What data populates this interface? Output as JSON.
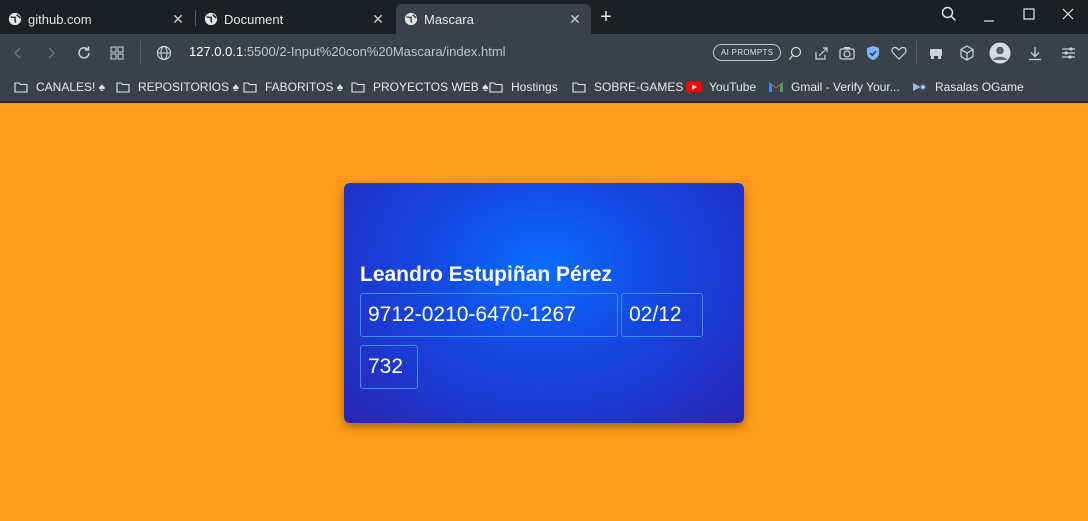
{
  "browser": {
    "tabs": [
      {
        "title": "github.com",
        "icon": "globe-icon"
      },
      {
        "title": "Document",
        "icon": "globe-icon"
      },
      {
        "title": "Mascara",
        "icon": "globe-icon"
      }
    ],
    "active_tab": 2,
    "url": {
      "host": "127.0.0.1",
      "path": ":5500/2-Input%20con%20Mascara/index.html"
    },
    "ai_prompts_label": "AI PROMPTS"
  },
  "bookmarks": [
    {
      "label": "CANALES! ♠",
      "icon": "folder-icon"
    },
    {
      "label": "REPOSITORIOS ♠",
      "icon": "folder-icon"
    },
    {
      "label": "FABORITOS ♠",
      "icon": "folder-icon"
    },
    {
      "label": "PROYECTOS WEB ♠",
      "icon": "folder-icon"
    },
    {
      "label": "Hostings",
      "icon": "folder-icon"
    },
    {
      "label": "SOBRE-GAMES",
      "icon": "folder-icon"
    },
    {
      "label": "YouTube",
      "icon": "youtube-icon"
    },
    {
      "label": "Gmail - Verify Your...",
      "icon": "gmail-icon"
    },
    {
      "label": "Rasalas OGame",
      "icon": "ogame-icon"
    }
  ],
  "card": {
    "holder_name": "Leandro Estupiñan Pérez",
    "card_number": "9712-0210-6470-1267",
    "expiry": "02/12",
    "cvc": "732"
  },
  "colors": {
    "page_background": "#ff9c1b",
    "card_center": "#0a6dff",
    "card_edge": "#2a25b6",
    "browser_chrome": "#3b4148"
  }
}
